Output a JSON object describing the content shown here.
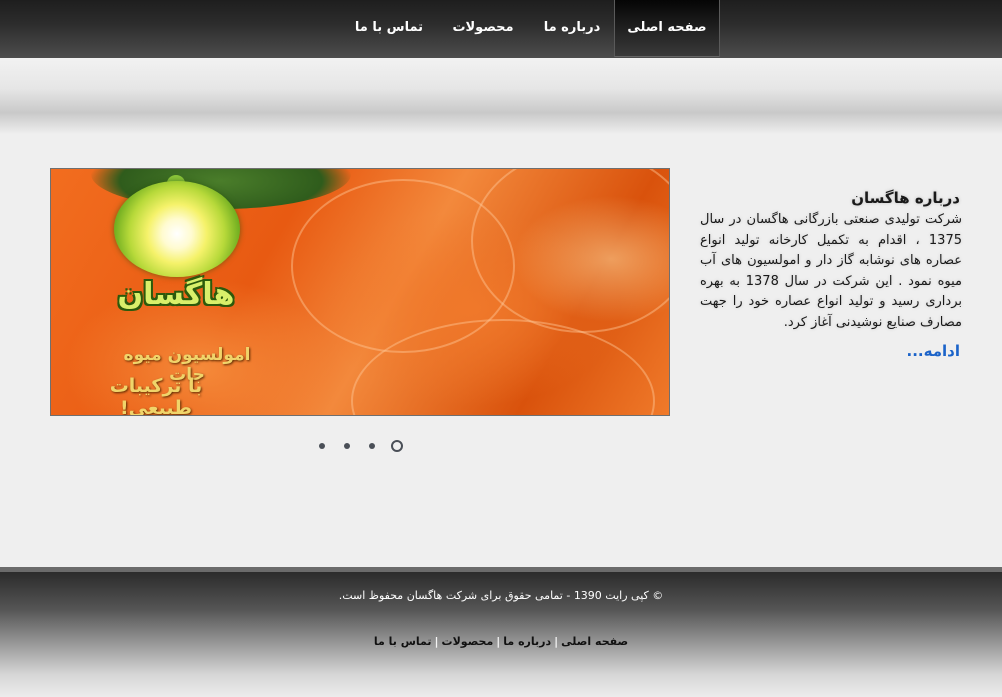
{
  "nav": {
    "items": [
      {
        "label": "صفحه اصلی",
        "active": true
      },
      {
        "label": "درباره ما",
        "active": false
      },
      {
        "label": "محصولات",
        "active": false
      },
      {
        "label": "تماس با ما",
        "active": false
      }
    ]
  },
  "about": {
    "title": "درباره هاگسان",
    "body": "شرکت تولیدی صنعتی بازرگانی هاگسان در سال 1375 ، اقدام به تکمیل کارخانه تولید انواع عصاره های نوشابه گاز دار و امولسیون های آب میوه نمود . این شرکت در سال 1378 به بهره برداری رسید و تولید انواع عصاره خود را جهت مصارف صنایع نوشیدنی آغاز کرد.",
    "more_label": "ادامه..."
  },
  "banner": {
    "logo_text": "هاگسان",
    "tagline_1": "امولسیون میوه جات",
    "tagline_2": "با ترکیبات طبیعی!",
    "background": "orange-slices-image"
  },
  "slideshow": {
    "slide_count": 4,
    "active_index": 3
  },
  "footer": {
    "copyright": "© کپی رایت 1390 - تمامی حقوق برای شرکت هاگسان محفوظ است.",
    "links": [
      "صفحه اصلی",
      "درباره ما",
      "محصولات",
      "تماس با ما"
    ]
  },
  "colors": {
    "link_accent": "#1b63c9",
    "nav_text": "#ffffff",
    "page_background": "#efefef"
  }
}
